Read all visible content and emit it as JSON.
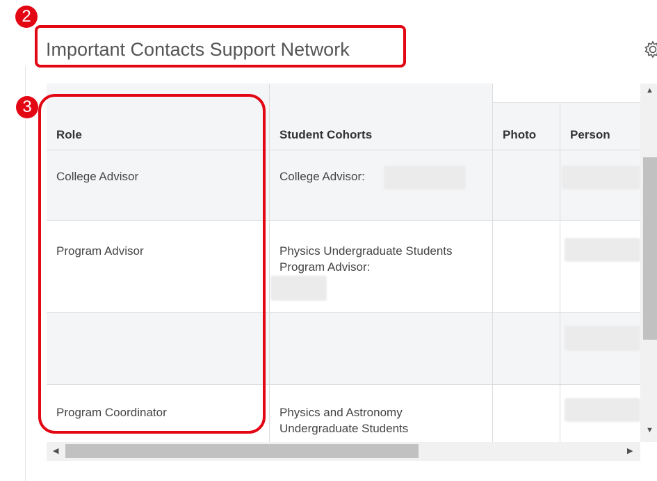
{
  "page": {
    "title": "Important Contacts Support Network",
    "settings_icon": "gear-icon"
  },
  "annotations": [
    {
      "label": "2",
      "color": "#e30613"
    },
    {
      "label": "3",
      "color": "#e30613"
    }
  ],
  "table": {
    "columns": [
      "Role",
      "Student Cohorts",
      "Photo",
      "Person"
    ],
    "rows": [
      {
        "role": "College Advisor",
        "cohort": "College Advisor:"
      },
      {
        "role": "Program Advisor",
        "cohort": "Physics Undergraduate Students Program Advisor:"
      },
      {
        "role": "",
        "cohort": ""
      },
      {
        "role": "Program Coordinator",
        "cohort": "Physics and Astronomy Undergraduate Students"
      }
    ]
  },
  "scrollbars": {
    "vertical": {
      "up_icon": "triangle-up-icon",
      "down_icon": "triangle-down-icon"
    },
    "horizontal": {
      "left_icon": "triangle-left-icon",
      "right_icon": "triangle-right-icon"
    }
  }
}
